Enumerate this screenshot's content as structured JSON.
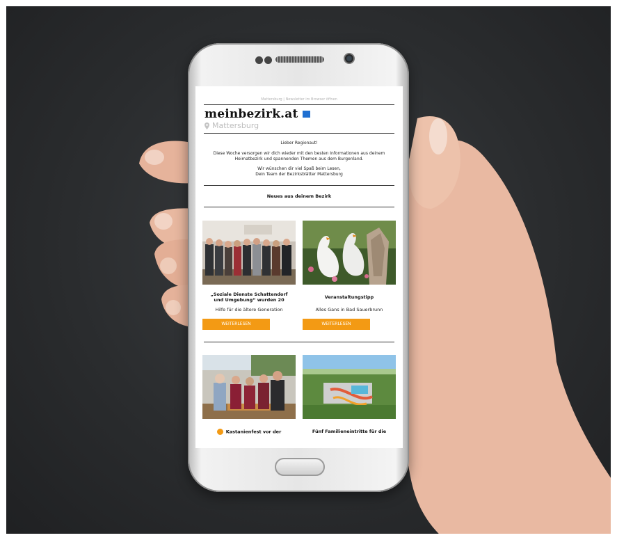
{
  "newsletter": {
    "header_links": "Mattersburg  |  Newsletter im Browser öffnen",
    "brand": "meinbezirk.at",
    "location": "Mattersburg",
    "greeting": "Lieber Regionaut!",
    "intro": "Diese Woche versorgen wir dich wieder mit den besten Informationen aus deinem Heimatbezirk und spannenden Themen aus dem Burgenland.",
    "closing_line1": "Wir wünschen dir viel Spaß beim Lesen,",
    "closing_line2": "Dein Team der Bezirksblätter Mattersburg",
    "section_title": "Neues aus deinem Bezirk"
  },
  "articles": [
    {
      "title": "„Soziale Dienste Schattendorf und Umgebung“ wurden 20",
      "subtitle": "Hilfe für die ältere Generation",
      "button": "WEITERLESEN"
    },
    {
      "title": "Veranstaltungstipp",
      "subtitle": "Alles Gans in Bad Sauerbrunn",
      "button": "WEITERLESEN"
    },
    {
      "title": "Kastanienfest vor der"
    },
    {
      "title": "Fünf Familieneintritte für die"
    }
  ],
  "colors": {
    "accent": "#f39a14",
    "brand_badge": "#1f6fd1"
  }
}
